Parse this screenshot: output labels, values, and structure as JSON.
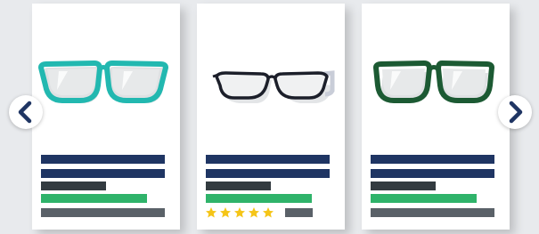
{
  "carousel": {
    "prev_icon": "chevron-left-icon",
    "next_icon": "chevron-right-icon",
    "arrow_color": "#1f3563"
  },
  "colors": {
    "title_bar": "#1f3563",
    "subtitle_bar": "#333b40",
    "price_bar": "#2fb36a",
    "action_bar": "#5a6168",
    "star": "#f5c518"
  },
  "products": [
    {
      "frame_color": "#22b8b0",
      "frame_style": "wayfarer"
    },
    {
      "frame_color": "#1c1f2a",
      "frame_style": "cat-eye",
      "rating": 5,
      "max_rating": 5
    },
    {
      "frame_color": "#1c5a33",
      "frame_style": "wayfarer"
    }
  ]
}
